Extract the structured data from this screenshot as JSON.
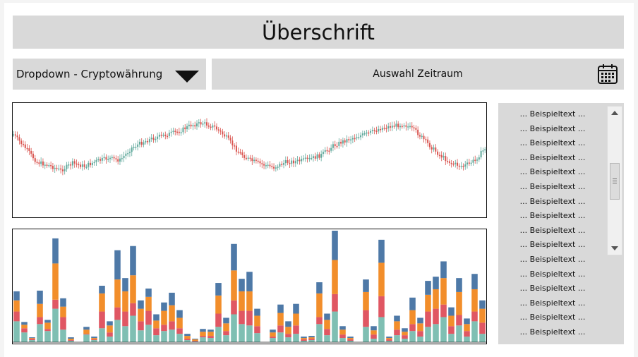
{
  "header": {
    "title": "Überschrift"
  },
  "controls": {
    "dropdown_label": "Dropdown - Cryptowährung",
    "daterange_label": "Auswahl Zeitraum"
  },
  "sidebar": {
    "items": [
      "... Beispieltext ...",
      "... Beispieltext ...",
      "... Beispieltext ...",
      "... Beispieltext ...",
      "... Beispieltext ...",
      "... Beispieltext ...",
      "... Beispieltext ...",
      "... Beispieltext ...",
      "... Beispieltext ...",
      "... Beispieltext ...",
      "... Beispieltext ...",
      "... Beispieltext ...",
      "... Beispieltext ...",
      "... Beispieltext ...",
      "... Beispieltext ...",
      "... Beispieltext ..."
    ]
  },
  "colors": {
    "panel_bg": "#d9d9d9",
    "candle_up": "#5fa89b",
    "candle_down": "#d9544f",
    "bar_teal": "#7fbfb3",
    "bar_red": "#e05763",
    "bar_orange": "#f28e2b",
    "bar_blue": "#4e79a7"
  },
  "icons": {
    "dropdown": "caret-down-icon",
    "daterange": "calendar-icon"
  },
  "chart_data": [
    {
      "type": "line",
      "description_series": "candlestick price trend",
      "x": [
        0,
        1,
        2,
        3,
        4,
        5,
        6,
        7,
        8,
        9,
        10,
        11,
        12,
        13,
        14,
        15,
        16,
        17,
        18,
        19,
        20,
        21,
        22,
        23,
        24,
        25,
        26,
        27,
        28,
        29,
        30,
        31,
        32,
        33,
        34,
        35,
        36,
        37,
        38,
        39,
        40
      ],
      "y": [
        75,
        62,
        48,
        45,
        40,
        47,
        44,
        49,
        52,
        50,
        62,
        68,
        72,
        75,
        78,
        84,
        86,
        82,
        72,
        58,
        50,
        46,
        43,
        48,
        49,
        51,
        55,
        64,
        69,
        73,
        76,
        81,
        83,
        85,
        78,
        66,
        55,
        47,
        44,
        50,
        64
      ]
    },
    {
      "type": "bar",
      "stacked": true,
      "series": [
        {
          "values": [
            30,
            14,
            3,
            26,
            16,
            48,
            18,
            2,
            0,
            11,
            3,
            20,
            8,
            32,
            23,
            38,
            17,
            25,
            10,
            16,
            18,
            12,
            3,
            1,
            7,
            6,
            22,
            10,
            40,
            26,
            24,
            13,
            0,
            6,
            14,
            7,
            12,
            2,
            3,
            26,
            10,
            44,
            6,
            2,
            0,
            22,
            5,
            36,
            2,
            10,
            5,
            16,
            8,
            22,
            26,
            36,
            12,
            24,
            8,
            30,
            12
          ]
        },
        {
          "values": [
            14,
            6,
            2,
            10,
            3,
            13,
            18,
            1,
            0,
            1,
            1,
            24,
            6,
            18,
            21,
            18,
            13,
            20,
            10,
            9,
            12,
            8,
            2,
            1,
            2,
            3,
            19,
            6,
            20,
            19,
            21,
            10,
            0,
            2,
            10,
            5,
            12,
            2,
            2,
            10,
            9,
            25,
            5,
            2,
            0,
            24,
            6,
            30,
            2,
            8,
            5,
            10,
            8,
            22,
            22,
            18,
            11,
            15,
            8,
            14,
            16
          ]
        },
        {
          "values": [
            16,
            5,
            1,
            19,
            9,
            52,
            15,
            2,
            0,
            6,
            2,
            26,
            10,
            40,
            29,
            40,
            18,
            20,
            11,
            20,
            23,
            15,
            4,
            2,
            6,
            6,
            26,
            11,
            43,
            28,
            28,
            15,
            0,
            6,
            18,
            10,
            17,
            2,
            2,
            34,
            13,
            49,
            7,
            2,
            0,
            26,
            6,
            48,
            2,
            12,
            5,
            20,
            11,
            24,
            28,
            38,
            15,
            33,
            10,
            32,
            20
          ]
        },
        {
          "values": [
            13,
            4,
            1,
            19,
            4,
            36,
            12,
            2,
            0,
            4,
            2,
            11,
            6,
            42,
            19,
            42,
            12,
            12,
            9,
            12,
            18,
            11,
            3,
            1,
            4,
            3,
            18,
            8,
            38,
            18,
            28,
            10,
            0,
            4,
            12,
            8,
            14,
            2,
            2,
            16,
            9,
            42,
            5,
            2,
            0,
            18,
            6,
            33,
            2,
            8,
            5,
            18,
            8,
            20,
            18,
            24,
            12,
            20,
            8,
            22,
            12
          ]
        }
      ]
    }
  ]
}
